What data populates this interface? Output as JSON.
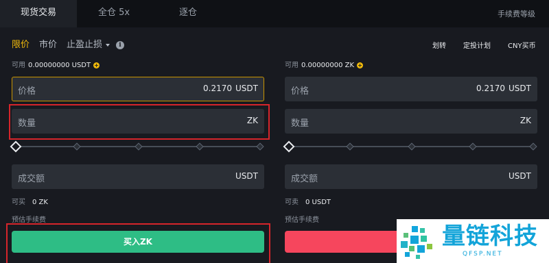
{
  "tabs": [
    {
      "label": "现货交易",
      "active": true
    },
    {
      "label": "全仓 5x",
      "active": false
    },
    {
      "label": "逐仓",
      "active": false
    }
  ],
  "fee_tier": "手续费等级",
  "order_types": {
    "limit": "限价",
    "market": "市价",
    "stop": "止盈止损"
  },
  "top_links": {
    "transfer": "划转",
    "plan": "定投计划",
    "cny": "CNY买币"
  },
  "buy": {
    "available_label": "可用",
    "available_value": "0.00000000 USDT",
    "price_label": "价格",
    "price_value": "0.2170",
    "price_unit": "USDT",
    "qty_label": "数量",
    "qty_unit": "ZK",
    "total_label": "成交额",
    "total_unit": "USDT",
    "can_label": "可买",
    "can_value": "0 ZK",
    "fee_label": "预估手续费",
    "button": "买入ZK"
  },
  "sell": {
    "available_label": "可用",
    "available_value": "0.00000000 ZK",
    "price_label": "价格",
    "price_value": "0.2170",
    "price_unit": "USDT",
    "qty_label": "数量",
    "qty_unit": "ZK",
    "total_label": "成交额",
    "total_unit": "USDT",
    "can_label": "可卖",
    "can_value": "0 USDT",
    "fee_label": "预估手续费",
    "button": ""
  },
  "slider_level": 0,
  "watermark": {
    "text": "量链科技",
    "url": "QFSP.NET"
  },
  "colors": {
    "accent": "#f0b90b",
    "buy": "#2ebd85",
    "sell": "#f6465d",
    "highlight": "#d7252b",
    "watermark": "#13a4d9"
  }
}
